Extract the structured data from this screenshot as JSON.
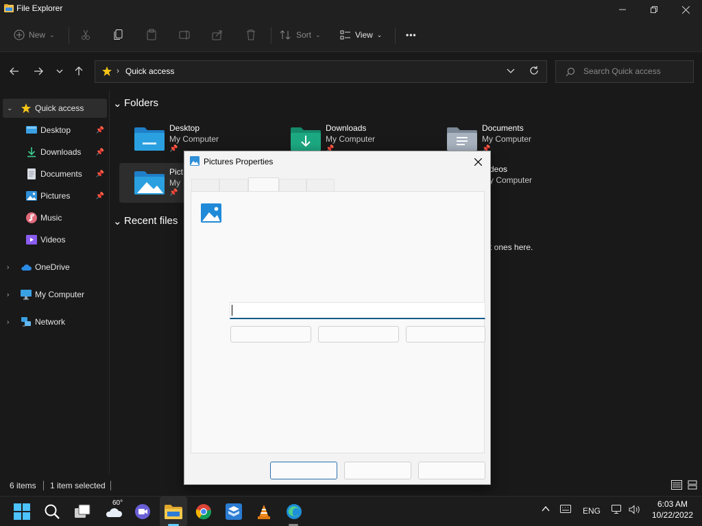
{
  "window": {
    "title": "File Explorer",
    "controls": {
      "minimize": "—",
      "maximize": "❐",
      "close": "✕"
    }
  },
  "toolbar": {
    "new_label": "New",
    "sort_label": "Sort",
    "view_label": "View",
    "more_label": "•••"
  },
  "address": {
    "crumb": "Quick access",
    "search_placeholder": "Search Quick access"
  },
  "sidebar": {
    "items": [
      {
        "label": "Quick access",
        "icon": "star-icon",
        "selected": true
      },
      {
        "label": "Desktop",
        "icon": "desktop-icon",
        "pinned": true
      },
      {
        "label": "Downloads",
        "icon": "download-icon",
        "pinned": true
      },
      {
        "label": "Documents",
        "icon": "document-icon",
        "pinned": true
      },
      {
        "label": "Pictures",
        "icon": "pictures-icon",
        "pinned": true
      },
      {
        "label": "Music",
        "icon": "music-icon"
      },
      {
        "label": "Videos",
        "icon": "videos-icon"
      },
      {
        "label": "OneDrive",
        "icon": "cloud-icon"
      },
      {
        "label": "My Computer",
        "icon": "computer-icon"
      },
      {
        "label": "Network",
        "icon": "network-icon"
      }
    ]
  },
  "main": {
    "folders_title": "Folders",
    "recent_title": "Recent files",
    "recent_hint_fragment": "t ones here.",
    "folders": [
      {
        "name": "Desktop",
        "location": "My Computer"
      },
      {
        "name": "Downloads",
        "location": "My Computer"
      },
      {
        "name": "Documents",
        "location": "My Computer"
      },
      {
        "name": "Pict",
        "location": "My",
        "selected": true
      },
      {
        "name": "deos",
        "location": "y Computer"
      }
    ]
  },
  "status": {
    "items_count": "6 items",
    "selection": "1 item selected"
  },
  "dialog": {
    "title": "Pictures Properties",
    "close": "✕",
    "tabs": [
      "",
      "",
      "",
      "",
      ""
    ],
    "active_tab_index": 2
  },
  "taskbar": {
    "weather": "60°",
    "language": "ENG",
    "time": "6:03 AM",
    "date": "10/22/2022"
  },
  "colors": {
    "accent": "#60cdff",
    "folder_blue": "#2aa0e0",
    "folder_green": "#1ca982",
    "input_focus": "#0f5b8a"
  }
}
